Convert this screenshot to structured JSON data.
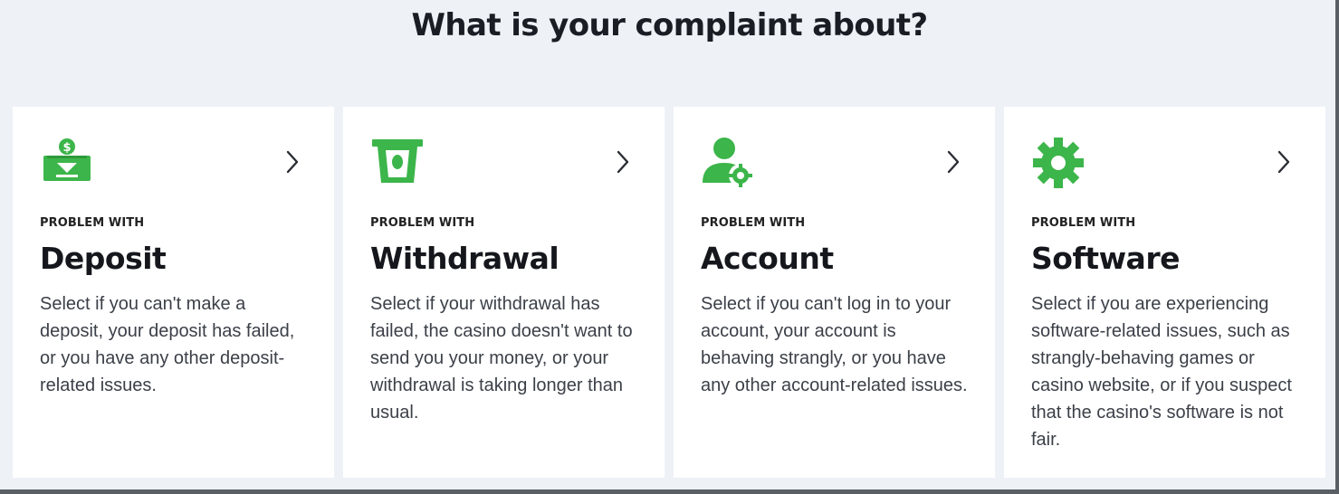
{
  "page": {
    "title": "What is your complaint about?"
  },
  "colors": {
    "accent": "#3cb54a",
    "background": "#eef2f7",
    "card": "#ffffff",
    "text": "#1a1d24"
  },
  "cards": [
    {
      "icon": "deposit-icon",
      "kicker": "PROBLEM WITH",
      "heading": "Deposit",
      "description": "Select if you can't make a deposit, your deposit has failed, or you have any other deposit-related issues."
    },
    {
      "icon": "withdrawal-icon",
      "kicker": "PROBLEM WITH",
      "heading": "Withdrawal",
      "description": "Select if your withdrawal has failed, the casino doesn't want to send you your money, or your withdrawal is taking longer than usual."
    },
    {
      "icon": "account-icon",
      "kicker": "PROBLEM WITH",
      "heading": "Account",
      "description": "Select if you can't log in to your account, your account is behaving strangly, or you have any other account-related issues."
    },
    {
      "icon": "gear-icon",
      "kicker": "PROBLEM WITH",
      "heading": "Software",
      "description": "Select if you are experiencing software-related issues, such as strangly-behaving games or casino website, or if you suspect that the casino's software is not fair."
    }
  ]
}
